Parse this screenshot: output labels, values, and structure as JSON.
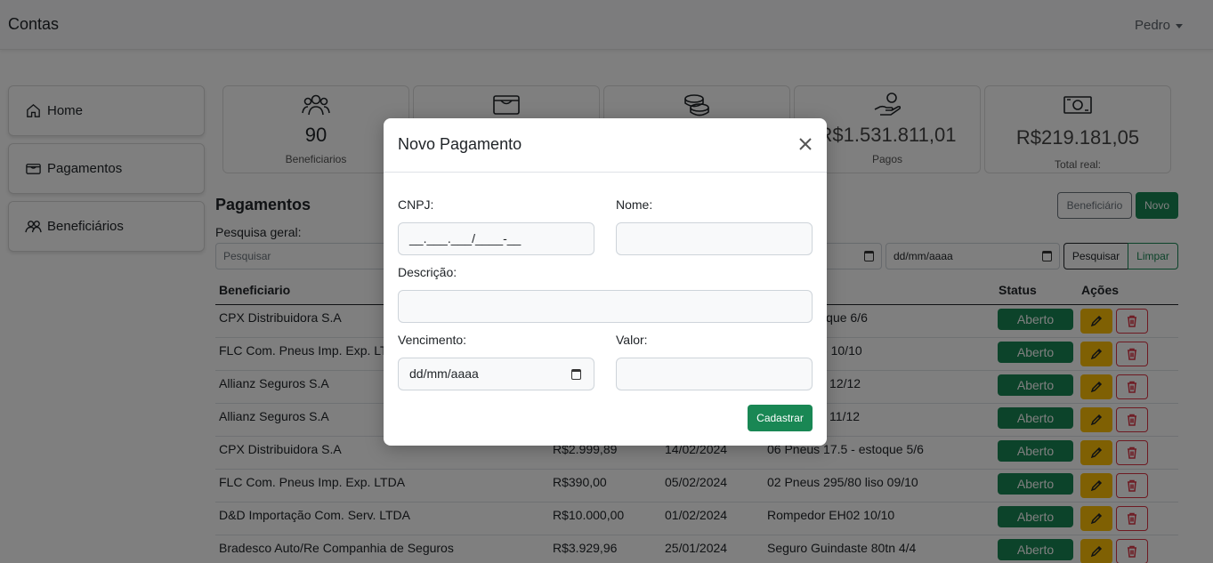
{
  "navbar": {
    "brand": "Contas",
    "user": "Pedro"
  },
  "sidebar": {
    "items": [
      {
        "label": "Home",
        "icon": "house-icon"
      },
      {
        "label": "Pagamentos",
        "icon": "wallet-icon"
      },
      {
        "label": "Beneficiários",
        "icon": "people-icon"
      }
    ]
  },
  "stats": {
    "cards": [
      {
        "value": "90",
        "label": "Beneficiarios",
        "icon": "people-icon"
      },
      {
        "value": "",
        "label": "",
        "icon": "wallet-icon"
      },
      {
        "value": "",
        "label": "",
        "icon": "coins-icon"
      },
      {
        "value": "R$1.531.811,01",
        "label": "Pagos",
        "icon": "hand-coin-icon"
      },
      {
        "value": "R$219.181,05",
        "label": "Total real:",
        "icon": "cash-icon"
      }
    ]
  },
  "main": {
    "title": "Pagamentos",
    "btn_beneficiario": "Beneficiário",
    "btn_novo": "Novo",
    "search_label": "Pesquisa geral:",
    "search_placeholder": "Pesquisar",
    "date_placeholder": "dd/mm/aaaa",
    "btn_pesquisar": "Pesquisar",
    "btn_limpar": "Limpar"
  },
  "table": {
    "headers": {
      "beneficiario": "Beneficiario",
      "status": "Status",
      "acoes": "Ações"
    },
    "rows": [
      {
        "beneficiario": "CPX Distribuidora S.A",
        "valor": "",
        "vencimento": "",
        "descricao": "17.5 - estoque 6/6",
        "status": "Aberto"
      },
      {
        "beneficiario": "FLC Com. Pneus Imp. Exp. LTDA",
        "valor": "",
        "vencimento": "",
        "descricao": "295/80 liso 10/10",
        "status": "Aberto"
      },
      {
        "beneficiario": "Allianz Seguros S.A",
        "valor": "",
        "vencimento": "",
        "descricao": "npregados 12/12",
        "status": "Aberto"
      },
      {
        "beneficiario": "Allianz Seguros S.A",
        "valor": "",
        "vencimento": "",
        "descricao": "npregados 11/12",
        "status": "Aberto"
      },
      {
        "beneficiario": "CPX Distribuidora S.A",
        "valor": "R$2.999,89",
        "vencimento": "14/02/2024",
        "descricao": "06 Pneus 17.5 - estoque 5/6",
        "status": "Aberto"
      },
      {
        "beneficiario": "FLC Com. Pneus Imp. Exp. LTDA",
        "valor": "R$390,00",
        "vencimento": "05/02/2024",
        "descricao": "02 Pneus 295/80 liso 09/10",
        "status": "Aberto"
      },
      {
        "beneficiario": "D&D Importação Com. Serv. LTDA",
        "valor": "R$10.000,00",
        "vencimento": "01/02/2024",
        "descricao": "Rompedor EH02 10/10",
        "status": "Aberto"
      },
      {
        "beneficiario": "Bradesco Auto/Re Companhia de Seguros",
        "valor": "R$3.929,96",
        "vencimento": "25/01/2024",
        "descricao": "Seguro Guindaste 80tn 4/4",
        "status": "Aberto"
      }
    ]
  },
  "modal": {
    "title": "Novo Pagamento",
    "cnpj_label": "CNPJ:",
    "cnpj_value": "__.___.___/____-__",
    "nome_label": "Nome:",
    "descricao_label": "Descrição:",
    "vencimento_label": "Vencimento:",
    "vencimento_value": "dd/mm/aaaa",
    "valor_label": "Valor:",
    "submit": "Cadastrar"
  },
  "colors": {
    "success": "#198754",
    "warning": "#ffc107",
    "danger": "#dc3545"
  }
}
